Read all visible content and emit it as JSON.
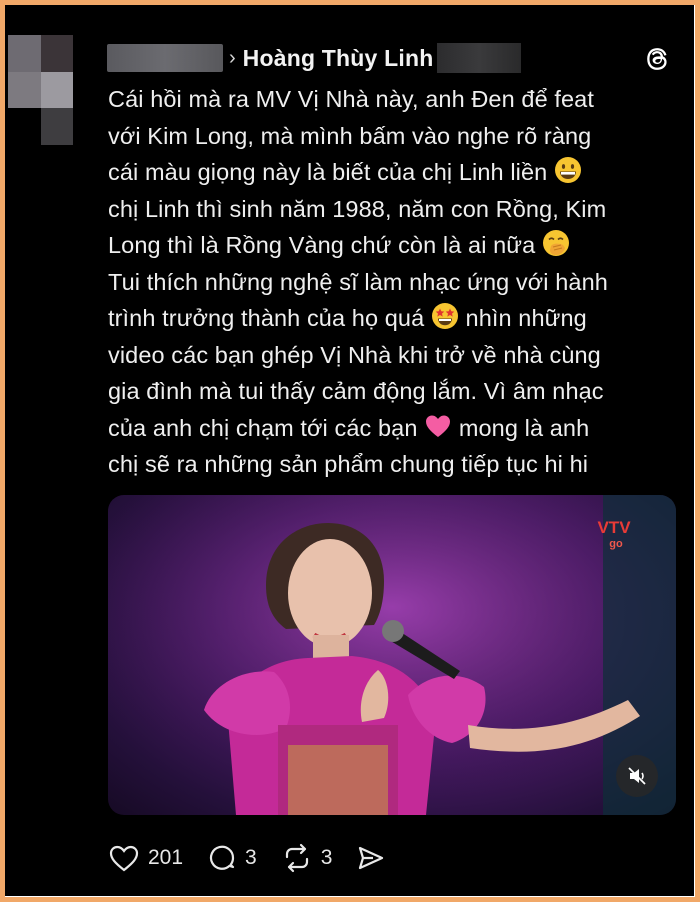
{
  "colors": {
    "card_background": "#000000",
    "frame_border": "#f1a868",
    "text_primary": "#efefef",
    "video_purple": "#5a1e78"
  },
  "post": {
    "author_name": "Hoàng Thùy Linh",
    "breadcrumb_separator": "›",
    "text_lines": [
      "Cái hồi mà ra MV Vị Nhà này, anh Đen để feat",
      "với Kim Long, mà mình bấm vào nghe rõ ràng",
      "cái màu giọng này là biết của chị Linh liền",
      "chị Linh thì sinh năm 1988, năm con Rồng, Kim",
      "Long thì là Rồng Vàng chứ còn là ai nữa",
      "Tui thích những nghệ sĩ làm nhạc ứng với hành",
      "trình trưởng thành của họ quá",
      "nhìn những",
      "video các bạn ghép Vị Nhà khi trở về nhà cùng",
      "gia đình mà tui thấy cảm động lắm. Vì âm nhạc",
      "của anh chị chạm tới các bạn",
      "mong là anh",
      "chị sẽ ra những sản phẩm chung tiếp tục hi hi"
    ],
    "emojis": [
      "grinning-face",
      "face-with-hand-over-mouth",
      "star-struck",
      "pink-heart"
    ]
  },
  "video": {
    "watermark_main": "VTV",
    "watermark_sub": "go"
  },
  "actions": {
    "likes": "201",
    "replies": "3",
    "reposts": "3"
  },
  "icons": {
    "brand": "threads-icon",
    "like": "heart-icon",
    "reply": "comment-icon",
    "repost": "repost-icon",
    "share": "send-icon",
    "mute": "muted-speaker-icon"
  }
}
